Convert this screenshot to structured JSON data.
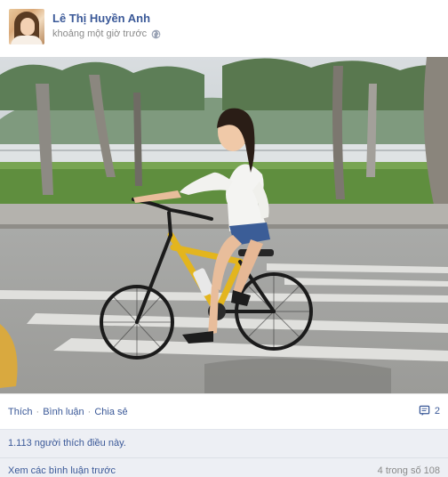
{
  "post": {
    "author_name": "Lê Thị Huyền Anh",
    "timestamp": "khoảng một giờ trước",
    "privacy_icon": "globe-icon"
  },
  "actions": {
    "like_label": "Thích",
    "comment_label": "Bình luận",
    "share_label": "Chia sẻ",
    "separator": "·",
    "comment_count": "2",
    "comment_icon": "comment-icon"
  },
  "likes": {
    "text": "1.113 người thích điều này."
  },
  "comments": {
    "view_previous": "Xem các bình luận trước",
    "pager": "4 trong số 108"
  },
  "colors": {
    "link": "#3b5998",
    "muted": "#8a8a8a",
    "panel": "#edeff4"
  }
}
